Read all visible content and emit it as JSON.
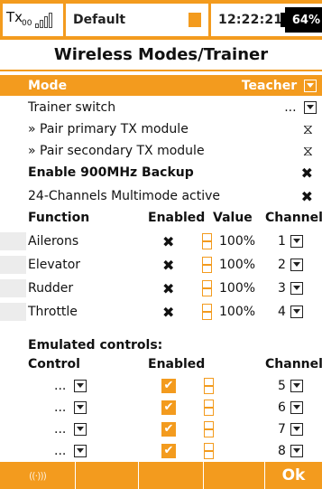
{
  "status": {
    "tx_label": "Tx",
    "tx_sub": "00",
    "model_name": "Default",
    "time": "12:22:21",
    "battery": "64%",
    "accent_color": "#f39b1e"
  },
  "title": "Wireless Modes/Trainer",
  "mode": {
    "label": "Mode",
    "value": "Teacher"
  },
  "settings": {
    "trainer_switch": {
      "label": "Trainer switch",
      "value": "..."
    },
    "pair_primary": {
      "label": "» Pair primary TX module"
    },
    "pair_secondary": {
      "label": "» Pair secondary TX module"
    },
    "enable_900": {
      "label": "Enable 900MHz Backup"
    },
    "multimode": {
      "label": "24-Channels Multimode active"
    }
  },
  "function_table": {
    "headers": {
      "function": "Function",
      "enabled": "Enabled",
      "value": "Value",
      "channel": "Channel"
    },
    "rows": [
      {
        "name": "Ailerons",
        "value": "100%",
        "channel": "1"
      },
      {
        "name": "Elevator",
        "value": "100%",
        "channel": "2"
      },
      {
        "name": "Rudder",
        "value": "100%",
        "channel": "3"
      },
      {
        "name": "Throttle",
        "value": "100%",
        "channel": "4"
      }
    ]
  },
  "emulated": {
    "section_label": "Emulated controls:",
    "headers": {
      "control": "Control",
      "enabled": "Enabled",
      "channel": "Channel"
    },
    "rows": [
      {
        "control": "...",
        "channel": "5"
      },
      {
        "control": "...",
        "channel": "6"
      },
      {
        "control": "...",
        "channel": "7"
      },
      {
        "control": "...",
        "channel": "8"
      }
    ]
  },
  "footer": {
    "ok_label": "Ok",
    "wifi_icon": "((·)))"
  }
}
